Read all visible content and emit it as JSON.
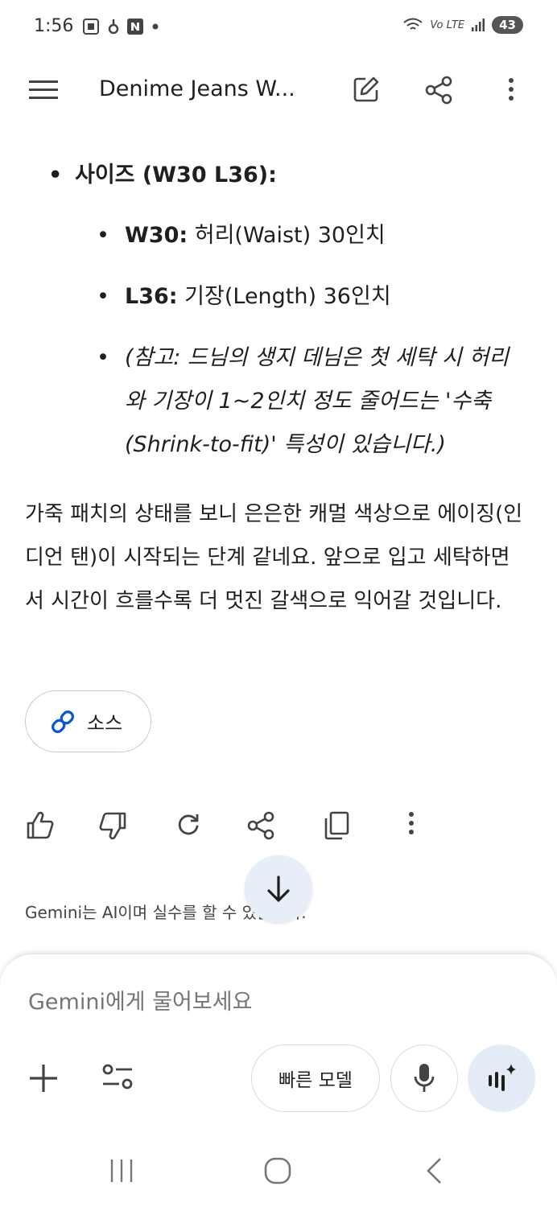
{
  "status_bar": {
    "time": "1:56",
    "network": "Vo LTE",
    "battery": "43"
  },
  "app_bar": {
    "title": "Denime Jeans W..."
  },
  "message": {
    "size_heading": "사이즈 (W30 L36):",
    "items": [
      {
        "label": "W30:",
        "text": " 허리(Waist) 30인치"
      },
      {
        "label": "L36:",
        "text": " 기장(Length) 36인치"
      }
    ],
    "note": "(참고: 드님의 생지 데님은 첫 세탁 시 허리와 기장이 1~2인치 정도 줄어드는 '수축(Shrink-to-fit)' 특성이 있습니다.)",
    "paragraph": "가죽 패치의 상태를 보니 은은한 캐멀 색상으로 에이징(인디언 탠)이 시작되는 단계 같네요. 앞으로 입고 세탁하면서 시간이 흐를수록 더 멋진 갈색으로 익어갈 것입니다.",
    "source_label": "소스"
  },
  "disclaimer": "Gemini는 AI이며 실수를 할 수 있습니다.",
  "input": {
    "placeholder": "Gemini에게 물어보세요",
    "model_label": "빠른 모델"
  },
  "colors": {
    "accent": "#0b57d0",
    "fab_bg": "#e8eef7",
    "live_bg": "#e3ebf6"
  },
  "icons": [
    "menu-icon",
    "edit-icon",
    "share-icon",
    "more-vert-icon",
    "link-icon",
    "thumbs-up-icon",
    "thumbs-down-icon",
    "regenerate-icon",
    "copy-icon",
    "arrow-down-icon",
    "plus-icon",
    "tools-icon",
    "mic-icon",
    "gemini-live-icon"
  ]
}
